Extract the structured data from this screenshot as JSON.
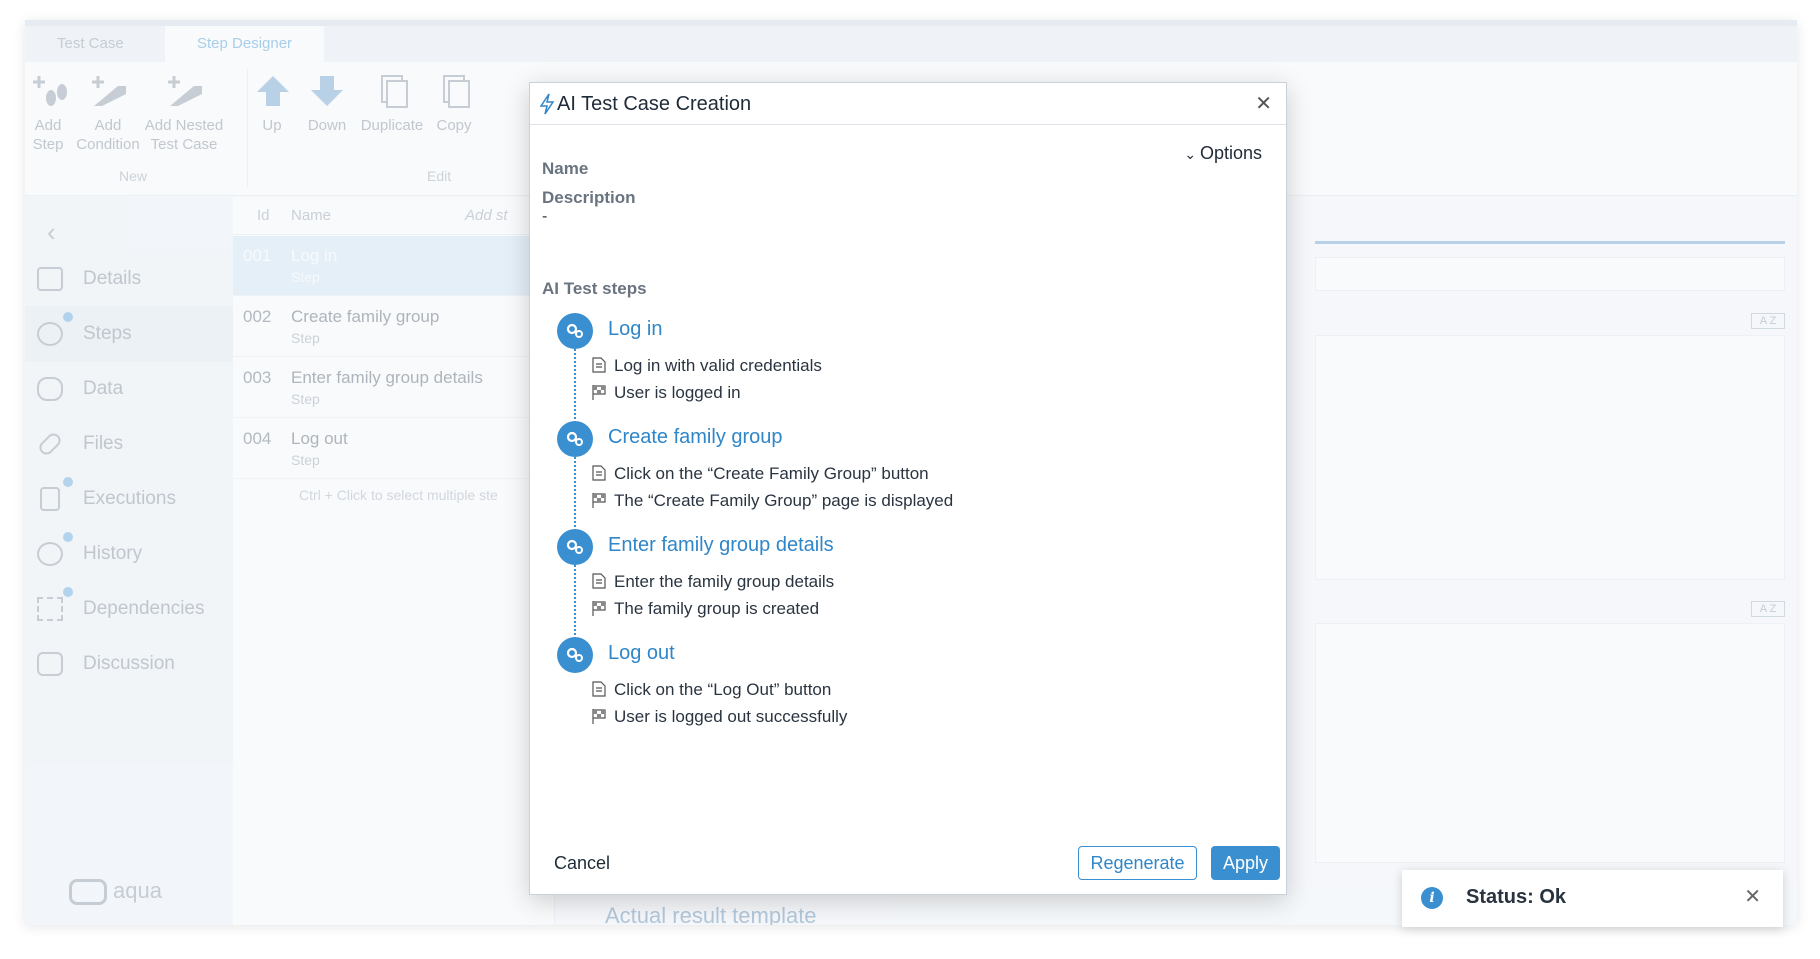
{
  "ribbon": {
    "tabs": [
      {
        "label": "Test Case"
      },
      {
        "label": "Step Designer"
      }
    ],
    "buttons": {
      "add_step": "Add\nStep",
      "add_condition": "Add\nCondition",
      "add_nested": "Add Nested\nTest Case",
      "up": "Up",
      "down": "Down",
      "duplicate": "Duplicate",
      "copy": "Copy"
    },
    "groups": {
      "new": "New",
      "edit": "Edit"
    }
  },
  "leftnav": {
    "items": [
      {
        "label": "Details"
      },
      {
        "label": "Steps"
      },
      {
        "label": "Data"
      },
      {
        "label": "Files"
      },
      {
        "label": "Executions"
      },
      {
        "label": "History"
      },
      {
        "label": "Dependencies"
      },
      {
        "label": "Discussion"
      }
    ],
    "logo": "aqua"
  },
  "steplist": {
    "col_id": "Id",
    "col_name": "Name",
    "add_step": "Add st",
    "rows": [
      {
        "id": "001",
        "name": "Log in",
        "type": "Step"
      },
      {
        "id": "002",
        "name": "Create family group",
        "type": "Step"
      },
      {
        "id": "003",
        "name": "Enter family group details",
        "type": "Step"
      },
      {
        "id": "004",
        "name": "Log out",
        "type": "Step"
      }
    ],
    "hint": "Ctrl + Click to select multiple ste"
  },
  "background": {
    "actual_result": "Actual result template",
    "badge": "A Z"
  },
  "modal": {
    "title": "AI Test Case Creation",
    "options": "Options",
    "name_label": "Name",
    "description_label": "Description",
    "description_value": "-",
    "steps_label": "AI Test steps",
    "steps": [
      {
        "title": "Log in",
        "action": "Log in with valid credentials",
        "expected": "User is logged in"
      },
      {
        "title": "Create family group",
        "action": "Click on the “Create Family Group” button",
        "expected": "The “Create Family Group” page is displayed"
      },
      {
        "title": "Enter family group details",
        "action": "Enter the family group details",
        "expected": "The family group is created"
      },
      {
        "title": "Log out",
        "action": "Click on the “Log Out” button",
        "expected": "User is logged out successfully"
      }
    ],
    "cancel": "Cancel",
    "regenerate": "Regenerate",
    "apply": "Apply"
  },
  "toast": {
    "status": "Status: Ok"
  },
  "colors": {
    "accent": "#3a8fd0",
    "selected_row": "#cfe3f5"
  }
}
